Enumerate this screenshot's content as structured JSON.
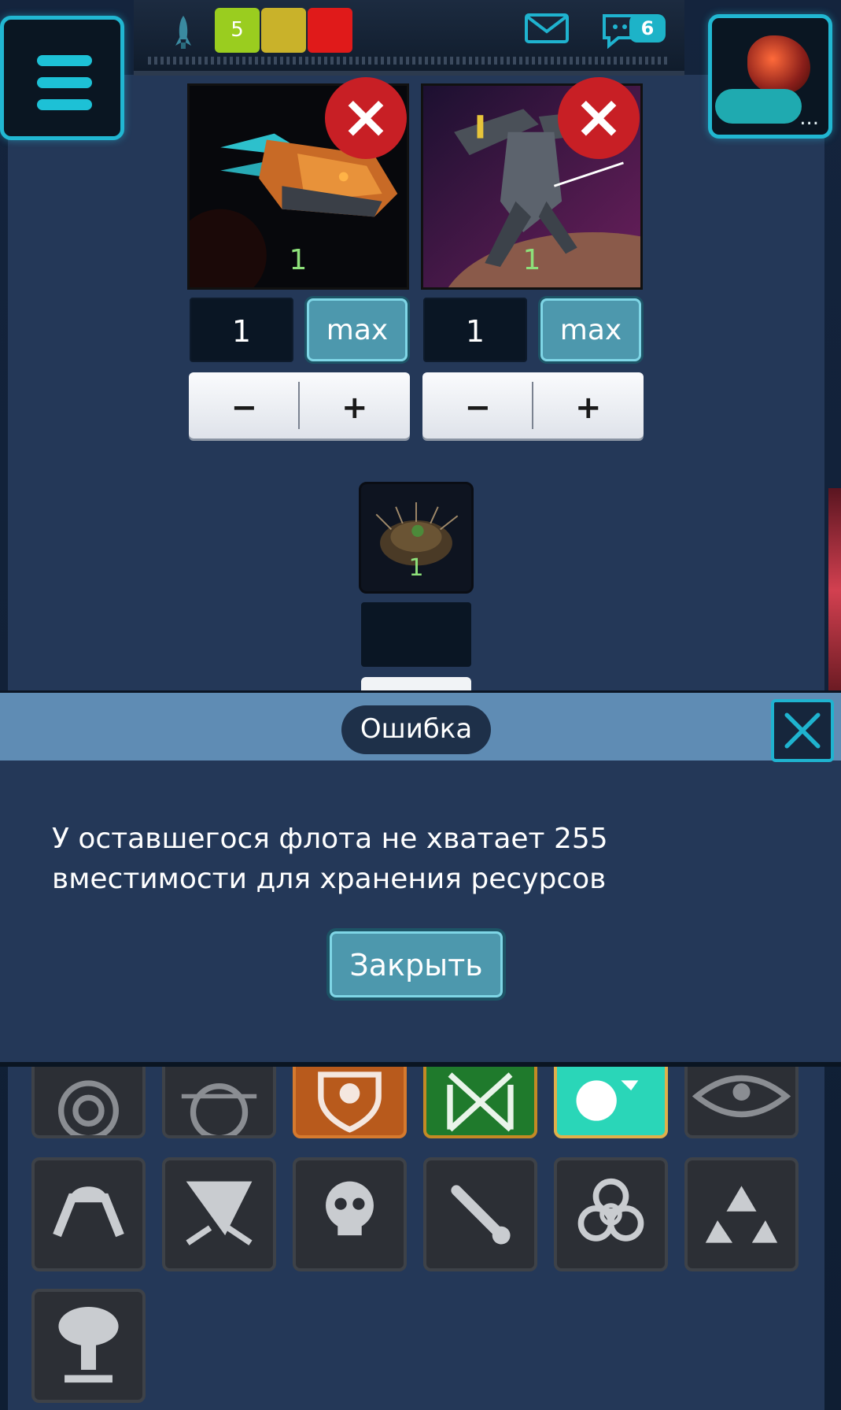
{
  "topbar": {
    "chips": [
      {
        "label": "5",
        "color": "#9acd1f"
      },
      {
        "label": "",
        "color": "#c9b22a"
      },
      {
        "label": "",
        "color": "#e01a1a"
      }
    ],
    "chat_count": "6",
    "player_name_suffix": "..."
  },
  "fleet": {
    "ships": [
      {
        "name": "orange-cruiser",
        "count": "1",
        "quantity": "1",
        "max_label": "max",
        "minus": "−",
        "plus": "+"
      },
      {
        "name": "mech-gunship",
        "count": "1",
        "quantity": "1",
        "max_label": "max",
        "minus": "−",
        "plus": "+"
      }
    ],
    "cargo": {
      "count": "1"
    }
  },
  "modal": {
    "title": "Ошибка",
    "message": "У оставшегося флота не хватает 255 вместимости для хранения ресурсов",
    "close_label": "Закрыть"
  },
  "abilities": [
    "target-icon",
    "radar-icon",
    "shield-icon",
    "swap-icon",
    "toggle-icon",
    "eye-icon",
    "lander-icon",
    "blast-icon",
    "skull-icon",
    "meteor-icon",
    "biohazard-icon",
    "recycle-icon",
    "nuke-icon"
  ]
}
